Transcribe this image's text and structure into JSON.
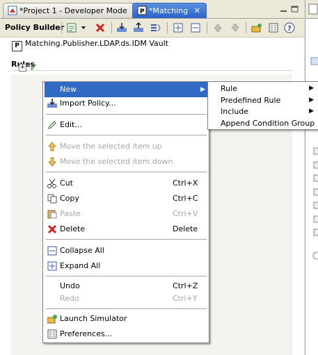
{
  "tabs": [
    {
      "label": "*Project 1 - Developer Mode"
    },
    {
      "label": "*Matching"
    }
  ],
  "toolbar": {
    "title": "Policy Builder"
  },
  "vault": {
    "name": "Matching.Publisher.LDAP.ds.IDM Vault",
    "badge": "P"
  },
  "rules": {
    "heading": "Rules"
  },
  "context_menu": [
    {
      "label": "New",
      "shortcut": "",
      "submenu": true,
      "highlighted": true,
      "disabled": false,
      "icon": ""
    },
    {
      "label": "Import Policy...",
      "shortcut": "",
      "disabled": false,
      "icon": "import-icon"
    },
    {
      "label": "Edit...",
      "shortcut": "",
      "disabled": false,
      "icon": "pencil-icon"
    },
    {
      "label": "Move the selected item up",
      "shortcut": "",
      "disabled": true,
      "icon": "arrow-up-icon"
    },
    {
      "label": "Move the selected item down",
      "shortcut": "",
      "disabled": true,
      "icon": "arrow-down-icon"
    },
    {
      "label": "Cut",
      "shortcut": "Ctrl+X",
      "disabled": false,
      "icon": "scissors-icon"
    },
    {
      "label": "Copy",
      "shortcut": "Ctrl+C",
      "disabled": false,
      "icon": "copy-icon"
    },
    {
      "label": "Paste",
      "shortcut": "Ctrl+V",
      "disabled": true,
      "icon": "paste-icon"
    },
    {
      "label": "Delete",
      "shortcut": "Delete",
      "disabled": false,
      "icon": "red-x-icon"
    },
    {
      "label": "Collapse All",
      "shortcut": "",
      "disabled": false,
      "icon": "collapse-icon"
    },
    {
      "label": "Expand All",
      "shortcut": "",
      "disabled": false,
      "icon": "expand-icon"
    },
    {
      "label": "Undo",
      "shortcut": "Ctrl+Z",
      "disabled": false,
      "icon": ""
    },
    {
      "label": "Redo",
      "shortcut": "Ctrl+Y",
      "disabled": true,
      "icon": ""
    },
    {
      "label": "Launch Simulator",
      "shortcut": "",
      "disabled": false,
      "icon": "simulator-icon"
    },
    {
      "label": "Preferences...",
      "shortcut": "",
      "disabled": false,
      "icon": "preferences-icon"
    }
  ],
  "submenu": [
    {
      "label": "Rule",
      "arrow": true
    },
    {
      "label": "Predefined Rule",
      "arrow": true
    },
    {
      "label": "Include",
      "arrow": true
    },
    {
      "label": "Append Condition Group",
      "arrow": false
    }
  ],
  "colors": {
    "highlight": "#316ac5",
    "active_tab": "#2c63c8",
    "check": "#2f9a2f",
    "delete": "#d02020"
  }
}
